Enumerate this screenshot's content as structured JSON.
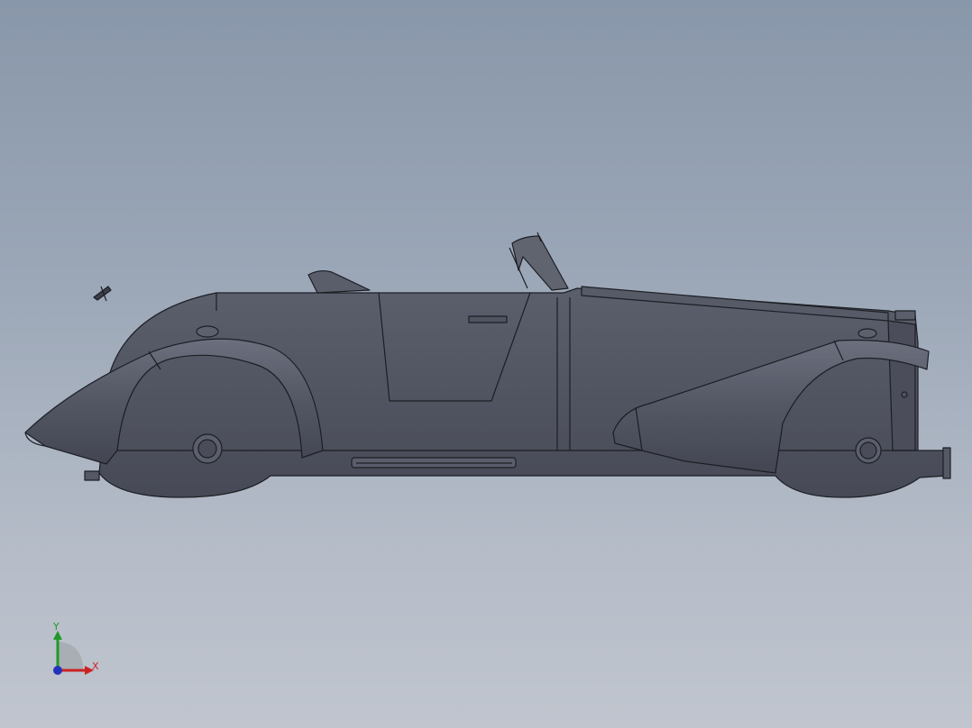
{
  "viewport": {
    "background_top": "#8997aa",
    "background_bottom": "#c0c5ce",
    "model": {
      "name": "roadster-side-view",
      "body_color": "#4e5260",
      "edge_color": "#1c1e24"
    }
  },
  "triad": {
    "x_label": "X",
    "y_label": "Y",
    "x_color": "#cc2222",
    "y_color": "#1f9a2a",
    "z_color": "#2233bb"
  }
}
